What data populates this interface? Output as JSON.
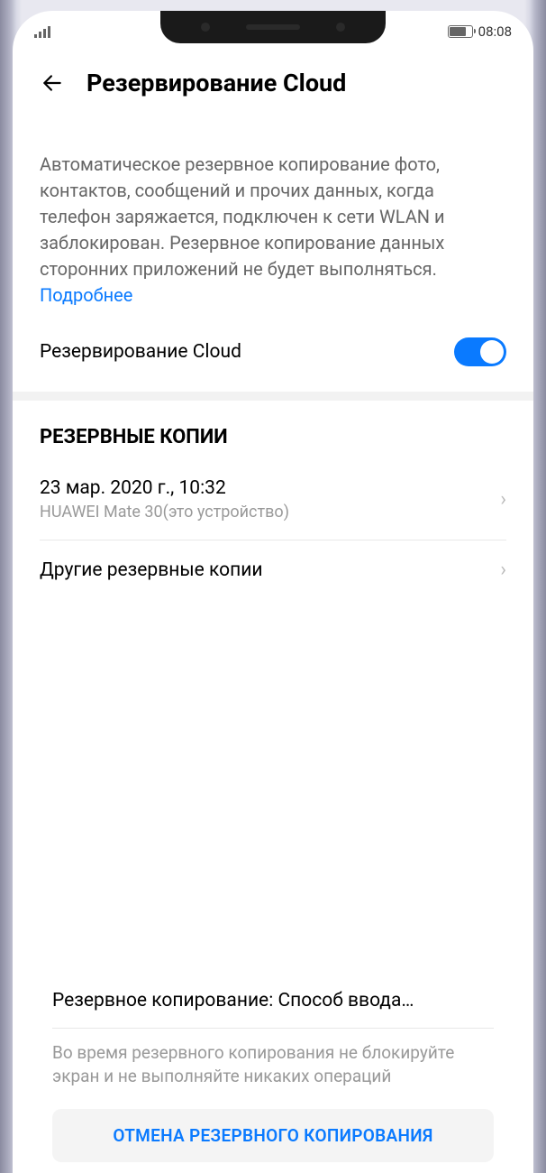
{
  "status_bar": {
    "time": "08:08"
  },
  "header": {
    "title": "Резервирование Cloud"
  },
  "description": {
    "text": "Автоматическое резервное копирование фото, контактов, сообщений и прочих данных, когда телефон заряжается, подключен к сети WLAN и заблокирован. Резервное копирование данных сторонних приложений не будет выполняться. ",
    "link": "Подробнее"
  },
  "toggle": {
    "label": "Резервирование Cloud",
    "enabled": true
  },
  "backups_section": {
    "header": "РЕЗЕРВНЫЕ КОПИИ",
    "items": [
      {
        "title": "23 мар. 2020 г., 10:32",
        "subtitle": "HUAWEI Mate 30(это устройство)"
      }
    ],
    "other_backups": "Другие резервные копии"
  },
  "bottom": {
    "progress": "Резервное копирование: Способ ввода…",
    "warning": "Во время резервного копирования не блокируйте экран и не выполняйте никаких операций",
    "cancel_button": "ОТМЕНА РЕЗЕРВНОГО КОПИРОВАНИЯ"
  }
}
